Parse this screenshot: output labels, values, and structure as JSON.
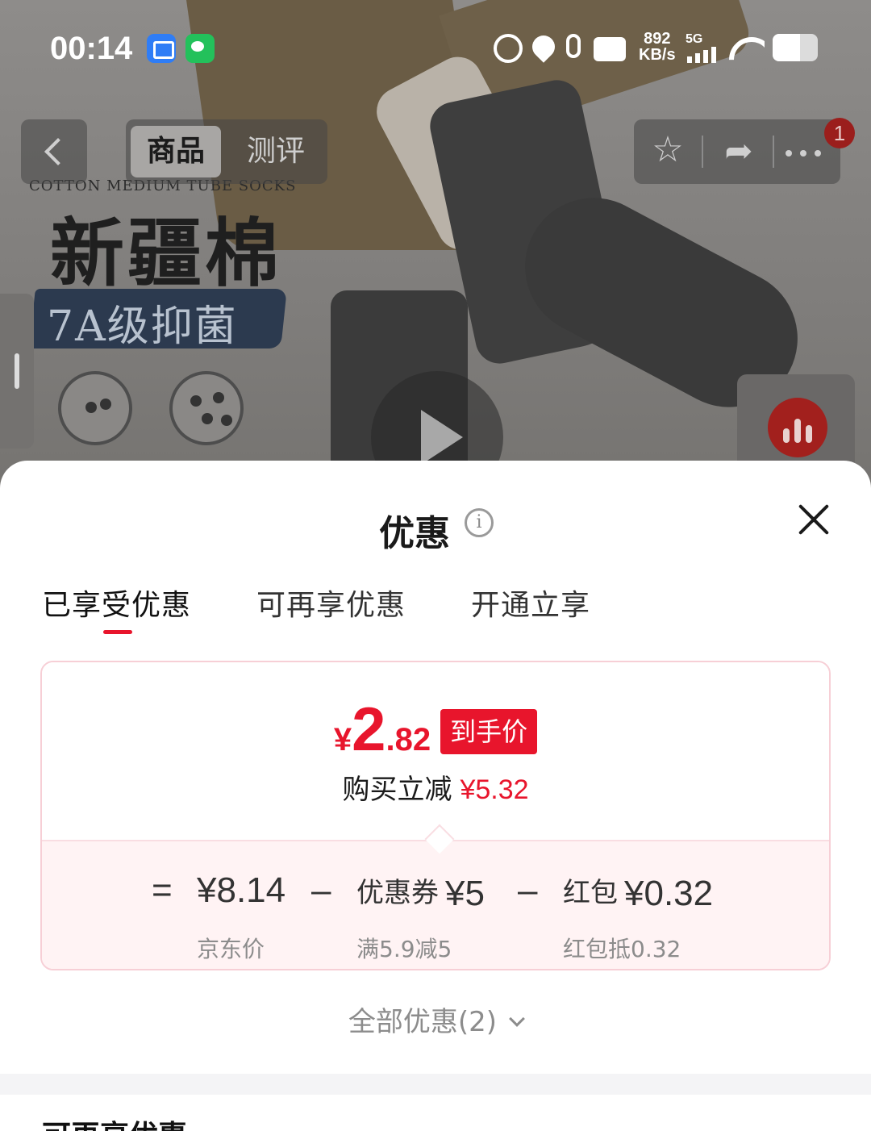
{
  "status_bar": {
    "time": "00:14",
    "speed_value": "892",
    "speed_unit": "KB/s",
    "network": "5G"
  },
  "hero": {
    "caption": "COTTON MEDIUM TUBE SOCKS",
    "title": "新疆棉",
    "grade": "7A级抑菌"
  },
  "nav": {
    "tabs": [
      {
        "label": "商品",
        "active": true
      },
      {
        "label": "测评",
        "active": false
      }
    ],
    "notification_count": "1",
    "icons": [
      "back-icon",
      "star-icon",
      "share-icon",
      "more-icon"
    ]
  },
  "sheet": {
    "title": "优惠",
    "tabs": [
      {
        "label": "已享受优惠",
        "active": true
      },
      {
        "label": "可再享优惠",
        "active": false
      },
      {
        "label": "开通立享",
        "active": false
      }
    ],
    "final_price": {
      "symbol": "¥",
      "integer": "2",
      "decimal": ".82",
      "tag": "到手价"
    },
    "saving": {
      "label": "购买立减",
      "amount": "¥5.32"
    },
    "formula": {
      "eq": "=",
      "minus": "–",
      "base_price": "¥8.14",
      "base_label": "京东价",
      "coupon_name": "优惠券",
      "coupon_value": "¥5",
      "coupon_rule": "满5.9减5",
      "redpacket_name": "红包",
      "redpacket_value": "¥0.32",
      "redpacket_rule": "红包抵0.32"
    },
    "all_offers": "全部优惠(2)",
    "next_section_title": "可再享优惠"
  },
  "colors": {
    "accent": "#e8152c",
    "card_border": "#f7cfd6",
    "card_bottom_bg": "#fff3f4"
  }
}
